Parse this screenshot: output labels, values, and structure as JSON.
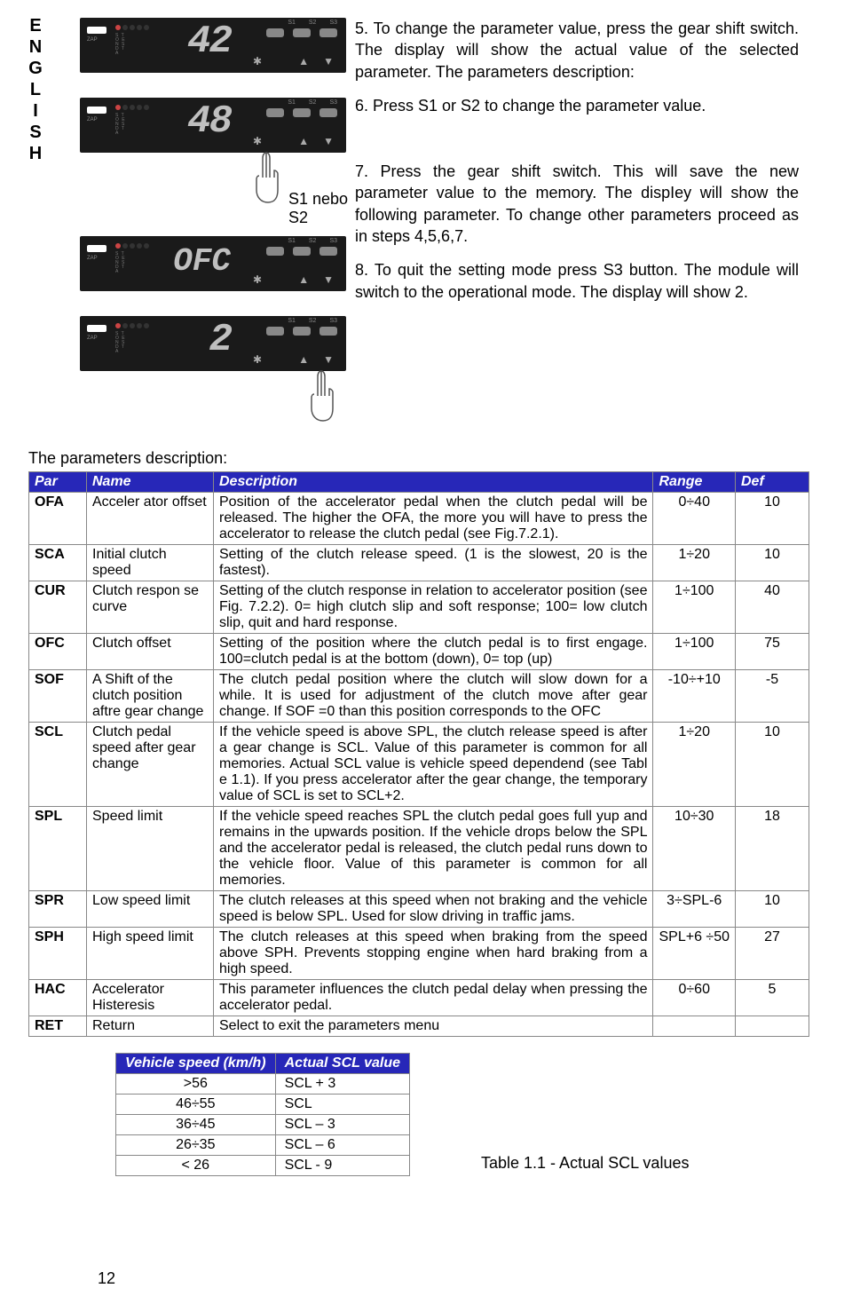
{
  "side_label": "ENGLISH",
  "devices": {
    "d1": "42",
    "d2": "48",
    "d3": "OFC",
    "d4": "2",
    "s1s2": "S1 nebo S2"
  },
  "steps": {
    "s5": "5. To change the parameter value, press the gear shift switch. The display will show the actual value of the selected parameter. The parameters description:",
    "s6": "6. Press S1 or S2 to change the parameter value.",
    "s7": "7. Press the gear shift switch. This will save the new parameter value to the memory. The dispIey will show the following parameter. To change other parameters proceed as in steps 4,5,6,7.",
    "s8": "8. To quit the setting mode press S3 button. The module will switch to the operational mode. The display will show 2."
  },
  "params_caption": "The parameters description:",
  "params_header": {
    "par": "Par",
    "name": "Name",
    "desc": "Description",
    "range": "Range",
    "def": "Def"
  },
  "params": [
    {
      "par": "OFA",
      "name": "Acceler ator offset",
      "desc": "Position of the accelerator pedal when the clutch pedal will be released. The higher the OFA, the more you will have to press the accelerator to release the clutch pedal (see Fig.7.2.1).",
      "range": "0÷40",
      "def": "10"
    },
    {
      "par": "SCA",
      "name": "Initial clutch speed",
      "desc": "Setting of the clutch release speed. (1 is the slowest, 20 is the fastest).",
      "range": "1÷20",
      "def": "10"
    },
    {
      "par": "CUR",
      "name": "Clutch respon se curve",
      "desc": "Setting of the clutch response in relation to accelerator position (see Fig. 7.2.2). 0= high clutch slip and soft response; 100= low clutch slip, quit and hard response.",
      "range": "1÷100",
      "def": "40"
    },
    {
      "par": "OFC",
      "name": "Clutch offset",
      "desc": "Setting of the position where the clutch pedal is to first engage. 100=clutch pedal is at the bottom (down), 0= top (up)",
      "range": "1÷100",
      "def": "75"
    },
    {
      "par": "SOF",
      "name": "A Shift of the clutch position aftre gear change",
      "desc": "The clutch pedal position where the clutch will slow down for a while. It is used for adjustment of the clutch move after gear change. If SOF =0 than this position corresponds to the OFC",
      "range": "-10÷+10",
      "def": "-5"
    },
    {
      "par": "SCL",
      "name": "Clutch pedal speed after gear change",
      "desc": "If the vehicle speed is above SPL, the clutch release speed is after a gear change is SCL. Value of this parameter is common for all memories. Actual SCL value is vehicle speed dependend (see Tabl e 1.1). If you press accelerator after the gear change, the temporary value of SCL is set to SCL+2.",
      "range": "1÷20",
      "def": "10"
    },
    {
      "par": "SPL",
      "name": "Speed limit",
      "desc": "If the vehicle speed reaches SPL the clutch pedal goes full yup and remains in the upwards position. If the vehicle drops below the SPL and the accelerator pedal is released, the clutch pedal runs down to the vehicle floor. Value of this parameter is common for all memories.",
      "range": "10÷30",
      "def": "18"
    },
    {
      "par": "SPR",
      "name": "Low speed limit",
      "desc": "The clutch releases at this speed when not braking and the vehicle speed is below SPL. Used for slow driving in traffic jams.",
      "range": "3÷SPL-6",
      "def": "10"
    },
    {
      "par": "SPH",
      "name": "High speed limit",
      "desc": "The clutch releases at this speed when braking from the speed above SPH. Prevents stopping engine when hard braking from a high speed.",
      "range": "SPL+6 ÷50",
      "def": "27"
    },
    {
      "par": "HAC",
      "name": "Accelerator Histeresis",
      "desc": "This parameter influences the clutch pedal delay when pressing the accelerator pedal.",
      "range": "0÷60",
      "def": "5"
    },
    {
      "par": "RET",
      "name": "Return",
      "desc": "Select to exit the parameters menu",
      "range": "",
      "def": ""
    }
  ],
  "scl_header": {
    "col1": "Vehicle speed (km/h)",
    "col2": "Actual SCL value"
  },
  "scl_rows": [
    {
      "speed": ">56",
      "val": "SCL + 3"
    },
    {
      "speed": "46÷55",
      "val": "SCL"
    },
    {
      "speed": "36÷45",
      "val": "SCL – 3"
    },
    {
      "speed": "26÷35",
      "val": "SCL – 6"
    },
    {
      "speed": "< 26",
      "val": "SCL - 9"
    }
  ],
  "table_caption": "Table 1.1 - Actual SCL values",
  "page_number": "12"
}
